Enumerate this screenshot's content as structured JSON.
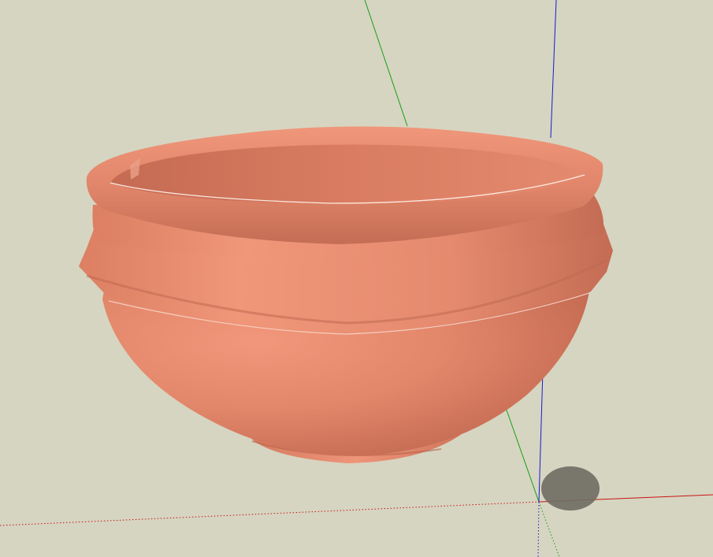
{
  "viewport": {
    "background_color": "#d6d5c1"
  },
  "axes": {
    "red_axis_color": "#c81414",
    "green_axis_color": "#16a016",
    "blue_axis_color": "#1a1ad0"
  },
  "model": {
    "object": "clay-bowl",
    "base_color": "#e48a6e",
    "shadow_color": "#6f6d62"
  }
}
